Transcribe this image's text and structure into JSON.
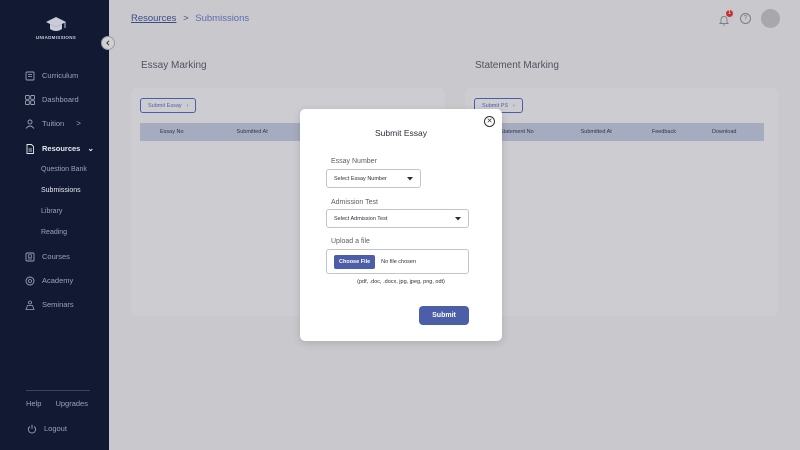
{
  "brand": {
    "logo_text": "UNIADMISSIONS"
  },
  "sidebar": {
    "items": [
      {
        "label": "Curriculum",
        "icon": "book-icon"
      },
      {
        "label": "Dashboard",
        "icon": "grid-icon"
      },
      {
        "label": "Tuition",
        "icon": "person-icon",
        "chevron": ">"
      },
      {
        "label": "Resources",
        "icon": "document-icon",
        "chevron": "⌄"
      },
      {
        "label": "Courses",
        "icon": "course-icon"
      },
      {
        "label": "Academy",
        "icon": "academy-icon"
      },
      {
        "label": "Seminars",
        "icon": "seminar-icon"
      }
    ],
    "resource_subitems": [
      "Question Bank",
      "Submissions",
      "Library",
      "Reading"
    ],
    "active_subitem": "Submissions",
    "help_label": "Help",
    "upgrades_label": "Upgrades",
    "logout_label": "Logout"
  },
  "header": {
    "breadcrumb_parent": "Resources",
    "breadcrumb_separator": ">",
    "breadcrumb_current": "Submissions",
    "notification_count": "1"
  },
  "essay_marking": {
    "title": "Essay Marking",
    "button_label": "Submit Essay",
    "columns": [
      "Essay No",
      "Submitted At"
    ]
  },
  "statement_marking": {
    "title": "Statement Marking",
    "button_label": "Submit PS",
    "columns": [
      "Statement No",
      "Submitted At",
      "Feedback",
      "Download"
    ]
  },
  "modal": {
    "title": "Submit Essay",
    "essay_number_label": "Essay Number",
    "essay_number_value": "Select Essay Number",
    "admission_test_label": "Admission Test",
    "admission_test_value": "Select Admission Test",
    "upload_label": "Upload a file",
    "choose_file_label": "Choose File",
    "no_file_text": "No file chosen",
    "formats_text": "(pdf, .doc, .docx, jpg, jpeg, png, odt)",
    "submit_label": "Submit"
  },
  "colors": {
    "sidebar_bg": "#121a33",
    "accent": "#4d5ea9",
    "overlay_bg": "#c9c9cd",
    "badge": "#c8302e"
  }
}
